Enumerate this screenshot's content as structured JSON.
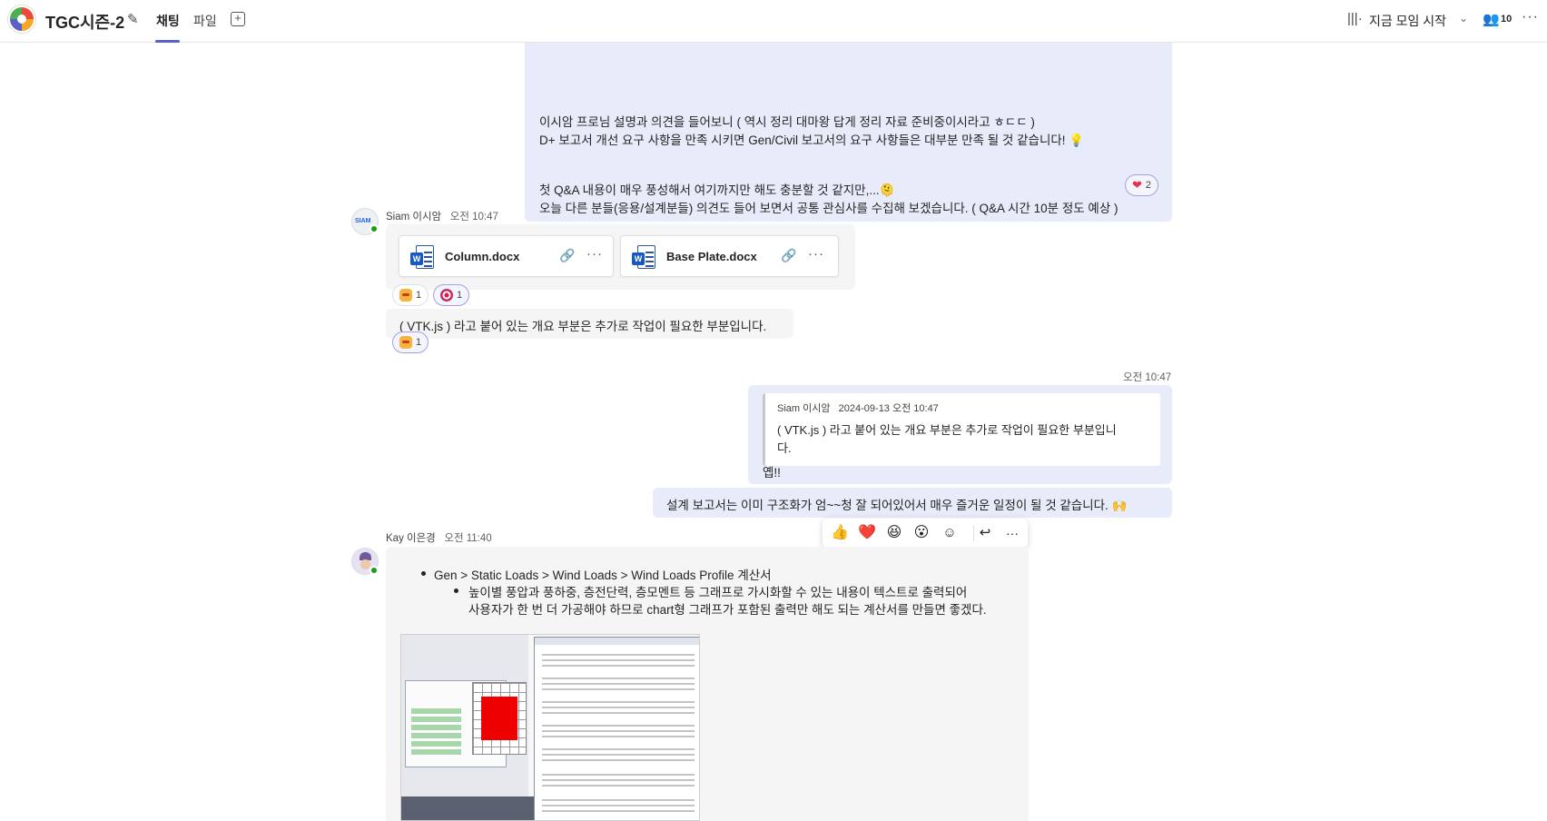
{
  "header": {
    "channel_title": "TGC시즌-2",
    "tabs": [
      {
        "label": "채팅",
        "active": true
      },
      {
        "label": "파일",
        "active": false
      }
    ],
    "meet_now_label": "지금 모임 시작",
    "participants_count": "10",
    "accent_color": "#5b5fc7"
  },
  "messages": {
    "m1": {
      "lines": [
        "이시암 프로님 설명과 의견을 들어보니 ( 역시 정리 대마왕 답게 정리 자료 준비중이시라고 ㅎㄷㄷ )",
        "D+ 보고서 개선 요구 사항을 만족 시키면 Gen/Civil 보고서의 요구 사항들은 대부분 만족 될 것 같습니다! 💡",
        "첫 Q&A 내용이 매우 풍성해서 여기까지만 해도 충분할 것 같지만,...🫠",
        "오늘 다른 분들(응용/설계분들) 의견도 들어 보면서 공통 관심사를 수집해 보겠습니다.   ( Q&A 시간 10분 정도  예상 )"
      ],
      "reaction_heart_count": "2"
    },
    "m2": {
      "author": "Siam 이시암",
      "time": "오전 10:47",
      "files": [
        {
          "name": "Column.docx",
          "icon": "word-icon"
        },
        {
          "name": "Base Plate.docx",
          "icon": "word-icon"
        }
      ],
      "reaction_cat_count": "1",
      "reaction_target_count": "1"
    },
    "m3": {
      "text": "( VTK.js ) 라고 붙어 있는 개요 부분은 추가로 작업이 필요한 부분입니다.",
      "reaction_cat_count": "1"
    },
    "m4": {
      "time": "오전 10:47",
      "quote_author": "Siam 이시암",
      "quote_time": "2024-09-13 오전 10:47",
      "quote_line1": "( VTK.js ) 라고 붙어 있는 개요 부분은 추가로 작업이 필요한 부분입니",
      "quote_line2": "다.",
      "text": "옙!!"
    },
    "m5": {
      "text": "설계 보고서는 이미 구조화가 엄~~청 잘 되어있어서 매우 즐거운 일정이 될 것 같습니다. 🙌"
    },
    "m6": {
      "author": "Kay 이은경",
      "time": "오전 11:40",
      "bullet1": "Gen > Static Loads > Wind Loads  > Wind Loads Profile 계산서",
      "bullet2_line1": "높이별 풍압과 풍하중, 층전단력, 층모멘트 등 그래프로 가시화할 수 있는 내용이 텍스트로 출력되어",
      "bullet2_line2": "사용자가 한 번 더 가공해야 하므로 chart형 그래프가 포함된 출력만 해도 되는 계산서를 만들면 좋겠다."
    }
  },
  "hover_toolbar": {
    "reactions": [
      "👍",
      "❤️",
      "😆",
      "😮"
    ],
    "icons": [
      "add-reaction-icon",
      "reply-icon",
      "more-icon"
    ]
  },
  "colors": {
    "self_bubble": "#e8ebfa",
    "other_bubble": "#f5f5f5",
    "presence_available": "#13a10e",
    "word_blue": "#185abd"
  }
}
